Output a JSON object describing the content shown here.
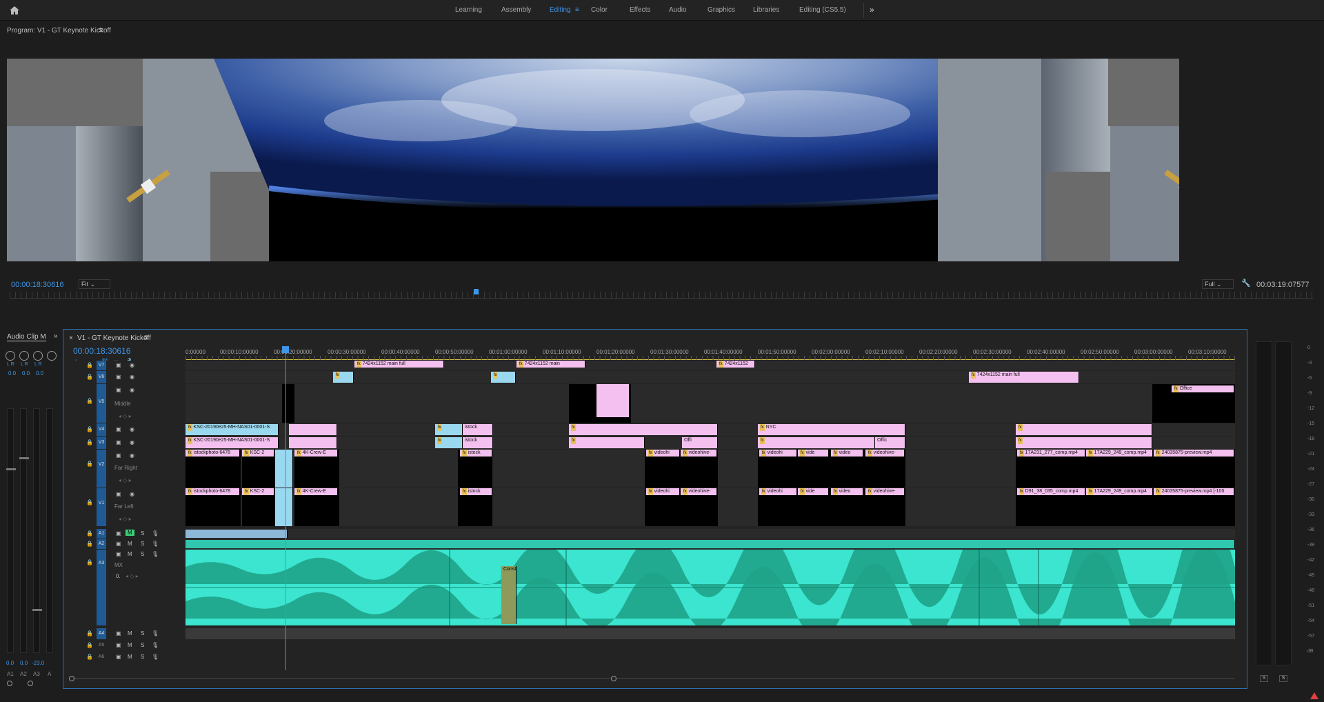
{
  "workspaces": {
    "tabs": [
      {
        "label": "Learning",
        "active": false
      },
      {
        "label": "Assembly",
        "active": false
      },
      {
        "label": "Editing",
        "active": true
      },
      {
        "label": "Color",
        "active": false
      },
      {
        "label": "Effects",
        "active": false
      },
      {
        "label": "Audio",
        "active": false
      },
      {
        "label": "Graphics",
        "active": false
      },
      {
        "label": "Libraries",
        "active": false
      },
      {
        "label": "Editing (CS5.5)",
        "active": false
      }
    ],
    "accent_color": "#3d96e8"
  },
  "program_monitor": {
    "title": "Program: V1 - GT Keynote Kickoff",
    "timecode": "00:00:18:30616",
    "fit": "Fit",
    "quality": "Full",
    "duration": "00:03:19:07577",
    "playhead_progress": 0.356
  },
  "audio_mixer": {
    "title": "Audio Clip M",
    "lr_label": "L R",
    "channels": [
      {
        "name": "A1",
        "pan": "0.0",
        "level": "0.0"
      },
      {
        "name": "A2",
        "pan": "0.0",
        "level": "0.0"
      },
      {
        "name": "A3",
        "pan": "0.0",
        "level": "-23.0"
      },
      {
        "name": "A",
        "pan": "",
        "level": ""
      }
    ]
  },
  "timeline": {
    "tab_title": "V1 - GT Keynote Kickoff",
    "timecode": "00:00:18:30616",
    "ruler": [
      "0:00000",
      "00:00:10:00000",
      "00:00:20:00000",
      "00:00:30:00000",
      "00:00:40:00000",
      "00:00:50:00000",
      "00:01:00:00000",
      "00:01:10:00000",
      "00:01:20:00000",
      "00:01:30:00000",
      "00:01:40:00000",
      "00:01:50:00000",
      "00:02:00:00000",
      "00:02:10:00000",
      "00:02:20:00000",
      "00:02:30:00000",
      "00:02:40:00000",
      "00:02:50:00000",
      "00:03:00:00000",
      "00:03:10:00000"
    ],
    "video_tracks": [
      {
        "name": "V7",
        "sub": ""
      },
      {
        "name": "V6",
        "sub": ""
      },
      {
        "name": "V5",
        "sub": "Middle"
      },
      {
        "name": "V4",
        "sub": ""
      },
      {
        "name": "V3",
        "sub": ""
      },
      {
        "name": "V2",
        "sub": "Far Right"
      },
      {
        "name": "V1",
        "sub": "Far Left"
      }
    ],
    "audio_tracks": [
      {
        "name": "A1",
        "sub": ""
      },
      {
        "name": "A2",
        "sub": ""
      },
      {
        "name": "A3",
        "sub": "MX"
      },
      {
        "name": "A4",
        "sub": ""
      },
      {
        "name": "A5",
        "sub": ""
      },
      {
        "name": "A6",
        "sub": ""
      }
    ],
    "track_button_labels": {
      "mute": "M",
      "solo": "S",
      "pan_value": "0."
    },
    "clip_labels": {
      "v7_a": "7424x1152 main full",
      "v7_b": "7424x1152 main",
      "v7_c": "7424x1152",
      "v6_main": "7424x1152 main full",
      "v5_office": "Office",
      "v4_ksc": "KSC-20190e25-MH-NAS01-0001-S",
      "v3_ksc": "KSC-20190e25-MH-NAS01-0001-S",
      "istock": "istock",
      "offi": "Offi",
      "nyc": "NYC",
      "offic": "Offic",
      "v2_istock": "istockphoto-6478",
      "ksc2": "KSC-2",
      "crew": "4K-Crew-E",
      "videohi": "videohi",
      "videohive": "videohive-",
      "vide": "vide",
      "video": "video",
      "v2_17a231": "17A231_277_comp.mp4",
      "v2_17a229": "17A229_249_comp.mp4",
      "v2_2403": "24035875-preview.mp4",
      "v1_d91": "D91_38_035_comp.mp4",
      "v1_17a229": "17A229_249_comp.mp4",
      "v1_2403": "24035875-preview.mp4 [-100",
      "a3_const": "Consta"
    }
  },
  "meters": {
    "scale": [
      "0",
      "-3",
      "-6",
      "-9",
      "-12",
      "-15",
      "-18",
      "-21",
      "-24",
      "-27",
      "-30",
      "-33",
      "-36",
      "-39",
      "-42",
      "-45",
      "-48",
      "-51",
      "-54",
      "-57",
      "dB"
    ],
    "solo": "S"
  }
}
